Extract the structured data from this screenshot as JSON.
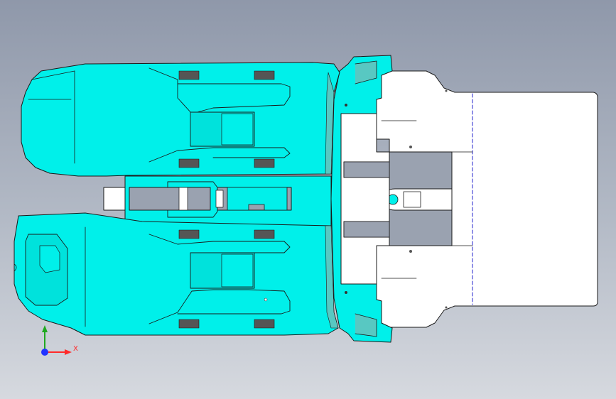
{
  "viewport": {
    "background_top": "#8f98aa",
    "background_bottom": "#d6d9df"
  },
  "model": {
    "part_color": "#00f0ea",
    "shadow_color": "#58c8c2",
    "plate_color": "#ffffff",
    "edge_color": "#1a1a1a",
    "hidden_edge_color": "#2222cc",
    "hole_color": "#555555"
  },
  "triad": {
    "x_label": "X",
    "x_color": "#ff2a2a",
    "y_color": "#1fa81f",
    "z_color": "#2233ff",
    "origin_icon": "axis-origin"
  }
}
